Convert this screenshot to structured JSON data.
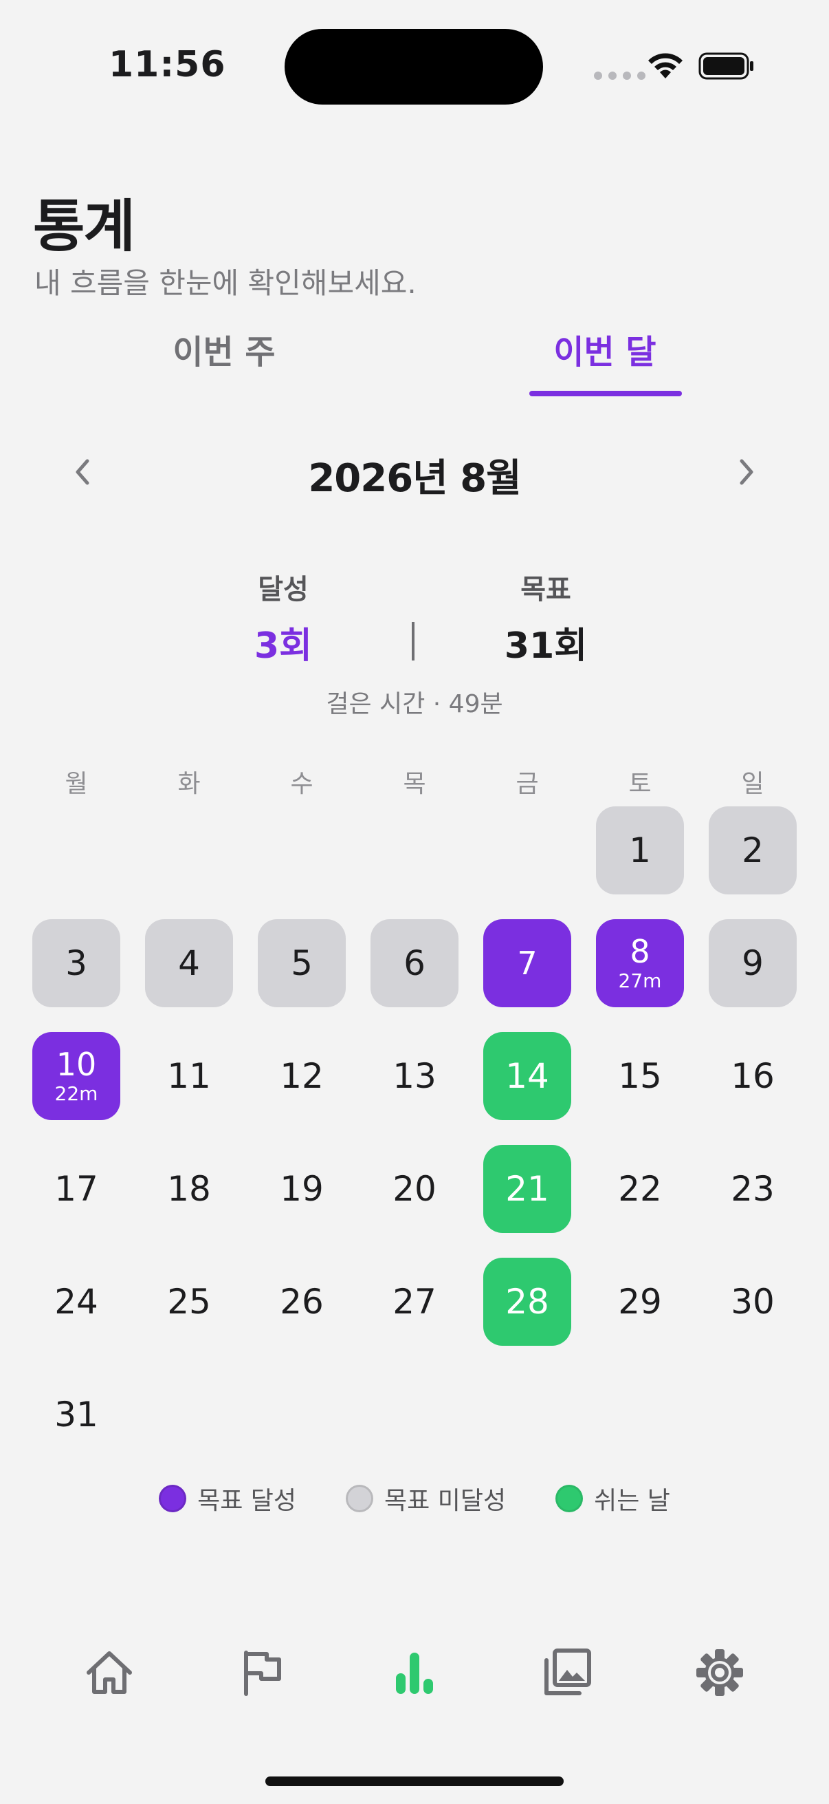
{
  "status_bar": {
    "time": "11:56"
  },
  "header": {
    "title": "통계",
    "subtitle": "내 흐름을 한눈에 확인해보세요."
  },
  "tabs": [
    {
      "label": "이번 주",
      "selected": false
    },
    {
      "label": "이번 달",
      "selected": true
    }
  ],
  "month_nav": {
    "title": "2026년 8월"
  },
  "summary": {
    "achieved_label": "달성",
    "achieved_value": "3회",
    "goal_label": "목표",
    "goal_value": "31회",
    "walk_time": "걸은 시간 · 49분"
  },
  "weekdays": [
    "월",
    "화",
    "수",
    "목",
    "금",
    "토",
    "일"
  ],
  "calendar": {
    "first_weekday_index": 5,
    "days": [
      {
        "day": "1",
        "status": "missed"
      },
      {
        "day": "2",
        "status": "missed"
      },
      {
        "day": "3",
        "status": "missed"
      },
      {
        "day": "4",
        "status": "missed"
      },
      {
        "day": "5",
        "status": "missed"
      },
      {
        "day": "6",
        "status": "missed"
      },
      {
        "day": "7",
        "status": "achieved"
      },
      {
        "day": "8",
        "status": "achieved",
        "minutes": "27m"
      },
      {
        "day": "9",
        "status": "missed"
      },
      {
        "day": "10",
        "status": "achieved",
        "minutes": "22m"
      },
      {
        "day": "11",
        "status": "none"
      },
      {
        "day": "12",
        "status": "none"
      },
      {
        "day": "13",
        "status": "none"
      },
      {
        "day": "14",
        "status": "rest"
      },
      {
        "day": "15",
        "status": "none"
      },
      {
        "day": "16",
        "status": "none"
      },
      {
        "day": "17",
        "status": "none"
      },
      {
        "day": "18",
        "status": "none"
      },
      {
        "day": "19",
        "status": "none"
      },
      {
        "day": "20",
        "status": "none"
      },
      {
        "day": "21",
        "status": "rest"
      },
      {
        "day": "22",
        "status": "none"
      },
      {
        "day": "23",
        "status": "none"
      },
      {
        "day": "24",
        "status": "none"
      },
      {
        "day": "25",
        "status": "none"
      },
      {
        "day": "26",
        "status": "none"
      },
      {
        "day": "27",
        "status": "none"
      },
      {
        "day": "28",
        "status": "rest"
      },
      {
        "day": "29",
        "status": "none"
      },
      {
        "day": "30",
        "status": "none"
      },
      {
        "day": "31",
        "status": "none"
      }
    ]
  },
  "legend": [
    {
      "label": "목표 달성",
      "color": "#7b2fe0"
    },
    {
      "label": "목표 미달성",
      "color": "#d3d3d7"
    },
    {
      "label": "쉬는 날",
      "color": "#2ec96f"
    }
  ],
  "colors": {
    "accent": "#7b2fe0",
    "rest": "#2ec96f",
    "missed": "#d3d3d7",
    "tab_active": "#2ec96f",
    "tab_inactive": "#6e6e72"
  },
  "tabbar": [
    {
      "icon": "home-icon",
      "active": false
    },
    {
      "icon": "flag-icon",
      "active": false
    },
    {
      "icon": "bar-chart-icon",
      "active": true
    },
    {
      "icon": "gallery-icon",
      "active": false
    },
    {
      "icon": "gear-icon",
      "active": false
    }
  ]
}
